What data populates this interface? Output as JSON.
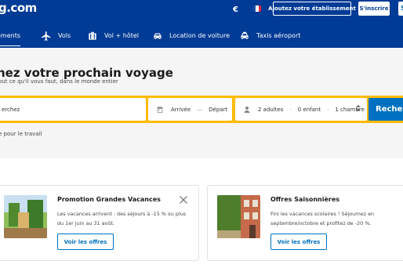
{
  "header": {
    "logo_text": "g.com",
    "currency": "€",
    "register_property": "Ajoutez votre établissement",
    "register": "S'inscrire",
    "signin_cut": "S",
    "colors": {
      "brand": "#003b95",
      "accent": "#0071c2",
      "highlight": "#febb02"
    }
  },
  "nav": {
    "tabs": [
      {
        "label": "ements",
        "icon": "bed-icon",
        "active": true
      },
      {
        "label": "Vols",
        "icon": "plane-icon"
      },
      {
        "label": "Vol + hôtel",
        "icon": "suitcase-icon"
      },
      {
        "label": "Location de voiture",
        "icon": "car-icon"
      },
      {
        "label": "Taxis aéroport",
        "icon": "taxi-icon"
      }
    ]
  },
  "hero": {
    "title": "hez votre prochain voyage",
    "subtitle": "out ce qu'il vous faut, dans le monde entier"
  },
  "search": {
    "destination_placeholder": "erchez",
    "checkin": "Arrivée",
    "date_separator": "—",
    "checkout": "Départ",
    "adults": "2 adultes",
    "children": "0 enfant",
    "rooms": "1 chambre",
    "dot": "·",
    "button": "Reche",
    "work_label": "e pour le travail"
  },
  "offers": [
    {
      "title": "Promotion Grandes Vacances",
      "text": "Les vacances arrivent : des séjours à -15 % ou plus du 1er juin au 31 août.",
      "button": "Voir les offres"
    },
    {
      "title": "Offres Saisonnières",
      "text": "Fini les vacances scolaires ! Séjournez en septembre/octobre et profitez de -20 %.",
      "button": "Voir les offres"
    }
  ]
}
